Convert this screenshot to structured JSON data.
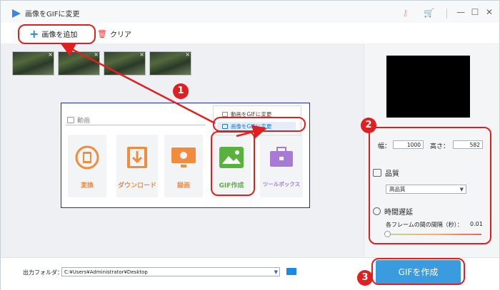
{
  "window": {
    "title": "画像をGIFに変更",
    "controls": {
      "minimize": "—",
      "maximize": "☐",
      "close": "✕"
    }
  },
  "toolbar": {
    "add_label": "画像を追加",
    "clear_label": "クリア"
  },
  "thumbnails": [
    {
      "remove": "×"
    },
    {
      "remove": "×"
    },
    {
      "remove": "×"
    },
    {
      "remove": "×"
    }
  ],
  "menu_panel": {
    "heading": "動画",
    "tiles": [
      {
        "label": "変換",
        "color": "#f08c3c",
        "icon": "film-convert-icon"
      },
      {
        "label": "ダウンロード",
        "color": "#f08c3c",
        "icon": "download-icon"
      },
      {
        "label": "録画",
        "color": "#f08c3c",
        "icon": "screen-record-icon"
      },
      {
        "label": "GIF作成",
        "color": "#59b23e",
        "icon": "gif-image-icon"
      },
      {
        "label": "ツールボックス",
        "color": "#a77ad6",
        "icon": "toolbox-icon"
      }
    ],
    "dropdown": [
      {
        "label": "動画をGIFに変更"
      },
      {
        "label": "画像をGIFに変更"
      }
    ]
  },
  "settings": {
    "width_label": "幅：",
    "width_value": "1000",
    "height_label": "高さ：",
    "height_value": "582",
    "quality_title": "品質",
    "quality_value": "高品質",
    "delay_title": "時間遅延",
    "delay_label": "各フレームの間の間隔（秒）：",
    "delay_value": "0.01"
  },
  "output": {
    "folder_label": "出力フォルダ：",
    "folder_path": "C:¥Users¥Administrator¥Desktop"
  },
  "create_button": "GIFを作成",
  "annotations": {
    "badge_1": "1",
    "badge_2": "2",
    "badge_3": "3",
    "color": "#e02020"
  }
}
